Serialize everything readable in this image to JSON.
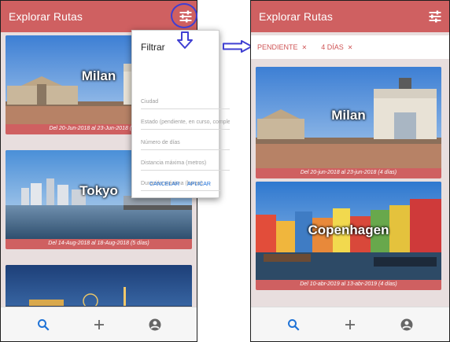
{
  "app": {
    "title": "Explorar Rutas"
  },
  "colors": {
    "primary": "#cf6061",
    "accent_blue": "#1d6fd8",
    "annotation": "#3f3fd2",
    "nav_active": "#1e72d6",
    "nav_inactive": "#666666"
  },
  "icons": {
    "filter": "tune-icon",
    "search": "search-icon",
    "add": "add-icon",
    "account": "account-icon"
  },
  "left": {
    "cards": [
      {
        "city": "Milan",
        "dates": "Del 20-Jun-2018 al 23-Jun-2018 (4 días)"
      },
      {
        "city": "Tokyo",
        "dates": "Del 14-Aug-2018 al 18-Aug-2018 (5 días)"
      },
      {
        "city": "",
        "dates": ""
      }
    ]
  },
  "filter_dialog": {
    "title": "Filtrar",
    "fields": [
      "Ciudad",
      "Estado (pendiente, en curso, completada)",
      "Número de días",
      "Distancia máxima (metros)",
      "Duración máxima (horas)"
    ],
    "cancel_label": "CANCELAR",
    "apply_label": "APLICAR"
  },
  "right": {
    "chips": [
      {
        "label": "PENDIENTE"
      },
      {
        "label": "4 DÍAS"
      }
    ],
    "cards": [
      {
        "city": "Milan",
        "dates": "Del 20-jun-2018 al 23-jun-2018 (4 días)"
      },
      {
        "city": "Copenhagen",
        "dates": "Del 10-abr-2019 al 13-abr-2019 (4 días)"
      }
    ]
  }
}
